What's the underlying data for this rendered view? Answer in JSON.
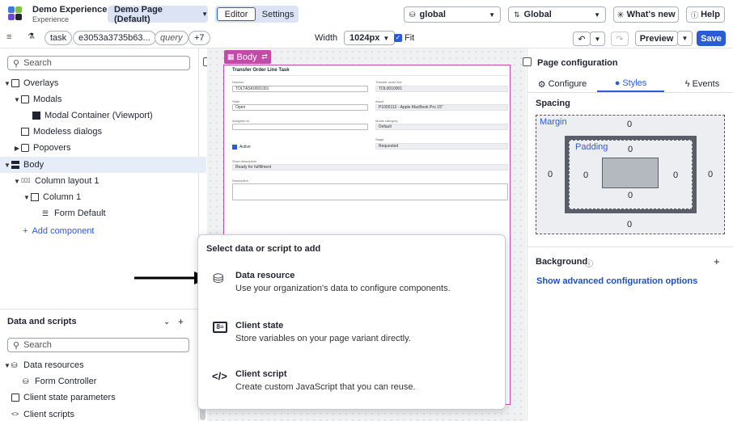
{
  "header": {
    "app_title": "Demo Experience",
    "app_subtitle": "Experience",
    "page_selector": "Demo Page (Default)",
    "tabs": [
      "Editor",
      "Settings"
    ],
    "scope_select": "global",
    "language_select": "Global",
    "whats_new": "What's new",
    "help": "Help"
  },
  "toolbar": {
    "chips": [
      "task",
      "e3053a3735b63...",
      "query",
      "+7"
    ],
    "width_label": "Width",
    "width_value": "1024px",
    "fit_label": "Fit",
    "preview_label": "Preview",
    "save_label": "Save"
  },
  "left": {
    "search_placeholder": "Search",
    "tree": [
      {
        "label": "Overlays"
      },
      {
        "label": "Modals"
      },
      {
        "label": "Modal Container (Viewport)"
      },
      {
        "label": "Modeless dialogs"
      },
      {
        "label": "Popovers"
      },
      {
        "label": "Body"
      },
      {
        "label": "Column layout 1"
      },
      {
        "label": "Column 1"
      },
      {
        "label": "Form Default"
      }
    ],
    "add_component": "Add component",
    "data_scripts_title": "Data and scripts",
    "data_search_placeholder": "Search",
    "data_tree": [
      {
        "label": "Data resources"
      },
      {
        "label": "Form Controller"
      },
      {
        "label": "Client state parameters"
      },
      {
        "label": "Client scripts"
      }
    ]
  },
  "canvas": {
    "body_tag": "Body",
    "form_title": "Transfer Order Line Task",
    "fields": {
      "number_label": "Number",
      "number_value": "TOLTASK0001001",
      "tol_label": "Transfer order line",
      "tol_value": "TOL0010001",
      "state_label": "State",
      "state_value": "Open",
      "asset_label": "Asset",
      "asset_value": "P1000112 - Apple MacBook Pro 15\"",
      "assigned_label": "Assigned to",
      "assigned_value": "",
      "model_cat_label": "Model category",
      "model_cat_value": "Default",
      "active_label": "Active",
      "stage_label": "Stage",
      "stage_value": "Requested",
      "short_desc_label": "Short description",
      "short_desc_value": "Ready for fulfillment",
      "desc_label": "Description"
    }
  },
  "popup": {
    "title": "Select data or script to add",
    "options": [
      {
        "title": "Data resource",
        "desc": "Use your organization's data to configure components."
      },
      {
        "title": "Client state",
        "desc": "Store variables on your page variant directly."
      },
      {
        "title": "Client script",
        "desc": "Create custom JavaScript that you can reuse."
      }
    ]
  },
  "right": {
    "title": "Page configuration",
    "tabs": [
      "Configure",
      "Styles",
      "Events"
    ],
    "spacing_title": "Spacing",
    "margin_label": "Margin",
    "padding_label": "Padding",
    "margin": {
      "top": "0",
      "right": "0",
      "bottom": "0",
      "left": "0"
    },
    "padding": {
      "top": "0",
      "right": "0",
      "bottom": "0",
      "left": "0"
    },
    "background_title": "Background",
    "advanced_link": "Show advanced configuration options"
  },
  "colors": {
    "accent": "#2b5cd8",
    "body_outline": "#c44aa8",
    "tab_active": "#2b5cd8"
  }
}
